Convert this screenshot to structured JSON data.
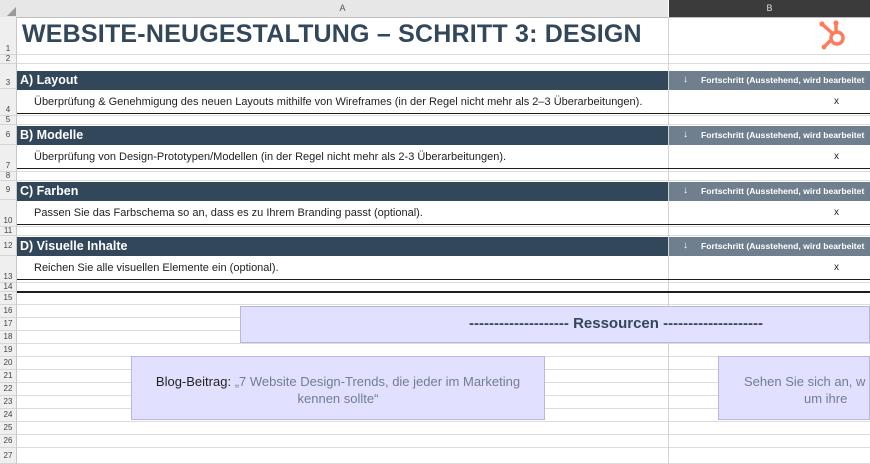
{
  "columns": [
    "A",
    "B"
  ],
  "rows": [
    "1",
    "2",
    "3",
    "4",
    "5",
    "6",
    "7",
    "8",
    "9",
    "10",
    "11",
    "12",
    "13",
    "14",
    "15",
    "16",
    "17",
    "18",
    "19",
    "20",
    "21",
    "22",
    "23",
    "24",
    "25",
    "26",
    "27"
  ],
  "title": "WEBSITE-NEUGESTALTUNG – SCHRITT 3: DESIGN",
  "progress_header": "Fortschritt (Ausstehend, wird bearbeitet",
  "sections": [
    {
      "label": "A) Layout",
      "task": "Überprüfung & Genehmigung des neuen Layouts mithilfe von Wireframes (in der Regel nicht mehr als 2–3 Überarbeitungen).",
      "mark": "x"
    },
    {
      "label": "B) Modelle",
      "task": "Überprüfung von Design-Prototypen/Modellen (in der Regel nicht mehr als 2-3 Überarbeitungen).",
      "mark": "x"
    },
    {
      "label": "C) Farben",
      "task": "Passen Sie das Farbschema so an, dass es zu Ihrem Branding passt (optional).",
      "mark": "x"
    },
    {
      "label": "D) Visuelle Inhalte",
      "task": "Reichen Sie alle visuellen Elemente ein (optional).",
      "mark": "x"
    }
  ],
  "resources": {
    "title": "-------------------- Ressourcen --------------------",
    "card1": {
      "label": "Blog-Beitrag:",
      "line1": "„7 Website Design-Trends, die jeder im Marketing",
      "line2": "kennen sollte“"
    },
    "card2": {
      "line1": "Sehen Sie sich an, w",
      "line2": "um ihre"
    }
  },
  "colors": {
    "section": "#33475b",
    "progress": "#6f7f8e",
    "resource": "#e2e0ff",
    "logo": "#ff7a59"
  }
}
